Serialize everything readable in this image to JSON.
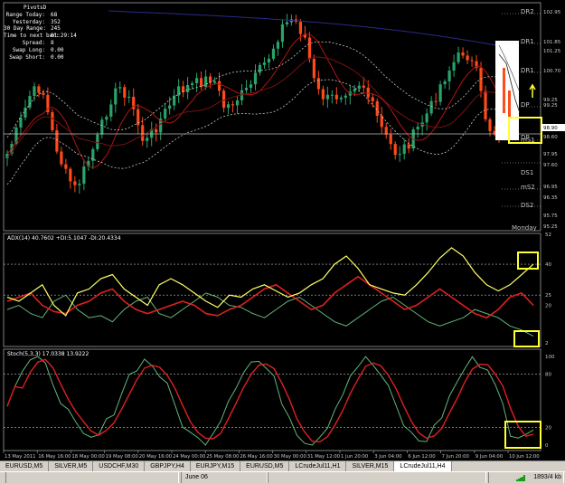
{
  "info_panel": {
    "title": "PivotsD",
    "rows": [
      {
        "label": "Range Today:",
        "value": "68"
      },
      {
        "label": "Yesterday:",
        "value": "352"
      },
      {
        "label": "30 Day Range:",
        "value": "245"
      },
      {
        "label": "Time to next bar:",
        "value": "01:29:14"
      },
      {
        "label": "Spread:",
        "value": "8"
      },
      {
        "label": "Swap Long:",
        "value": "0.00"
      },
      {
        "label": "Swap Short:",
        "value": "0.00"
      }
    ]
  },
  "price_axis": [
    "102.95",
    "101.85",
    "101.25",
    "100.70",
    "99.25",
    "99.25",
    "98.90",
    "98.60",
    "97.95",
    "97.60",
    "96.95",
    "96.35",
    "95.75",
    "95.25"
  ],
  "pivot_labels": [
    "DR2",
    "DR1",
    "DR1",
    "DP",
    "DP",
    "mS1",
    "DS1",
    "mS2",
    "DS2",
    "Monday"
  ],
  "adx": {
    "label": "ADX(14) 40.7602 +DI:5.1047 -DI:20.4334",
    "axis": [
      "52",
      "40",
      "25",
      "20",
      "2"
    ]
  },
  "stoch": {
    "label": "Stoch(5,3,3) 17.0338 13.9222",
    "axis": [
      "100",
      "80",
      "20",
      "0"
    ]
  },
  "time_axis": [
    "13 May 2011",
    "16 May 16:00",
    "18 May 00:00",
    "19 May 08:00",
    "20 May 16:00",
    "24 May 00:00",
    "25 May 08:00",
    "26 May 16:00",
    "30 May 00:00",
    "31 May 12:00",
    "1 Jun 20:00",
    "3 Jun 04:00",
    "6 Jun 12:00",
    "7 Jun 20:00",
    "9 Jun 04:00",
    "10 Jun 12:00"
  ],
  "tabs": [
    "EURUSD,M5",
    "SILVER,M5",
    "USDCHF,M30",
    "GBPJPY,H4",
    "EURJPY,M15",
    "EURUSD,M5",
    "LCrudeJul11,H1",
    "SILVER,M15",
    "LCrudeJul11,H4"
  ],
  "active_tab": 8,
  "status": {
    "date": "June 06",
    "traffic": "1893/4 kb"
  },
  "colors": {
    "up": "#2aa36b",
    "down": "#ff4a1a",
    "ma_red": "#b31414",
    "ma_blue": "#2a2a8c",
    "band": "#c8c8c8",
    "yellow": "#ffff33",
    "green": "#63b57a",
    "red": "#e02020"
  }
}
